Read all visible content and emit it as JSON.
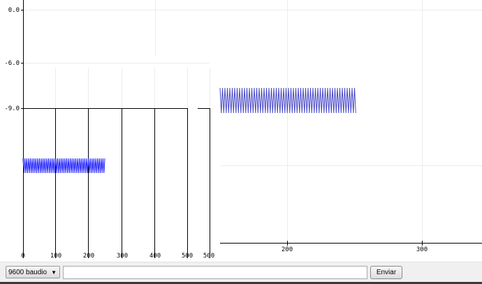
{
  "left_plot": {
    "y_ticks": [
      "0.0",
      "-6.0",
      "-9.0"
    ],
    "x_ticks": [
      "0",
      "100",
      "200",
      "300",
      "400",
      "500",
      "500"
    ],
    "series_color": "#1a1aff"
  },
  "right_plot": {
    "x_ticks": [
      "200",
      "300"
    ],
    "series_color": "#4848c8"
  },
  "toolbar": {
    "baud_value": "9600 baudio",
    "message_value": "",
    "send_label": "Enviar"
  }
}
